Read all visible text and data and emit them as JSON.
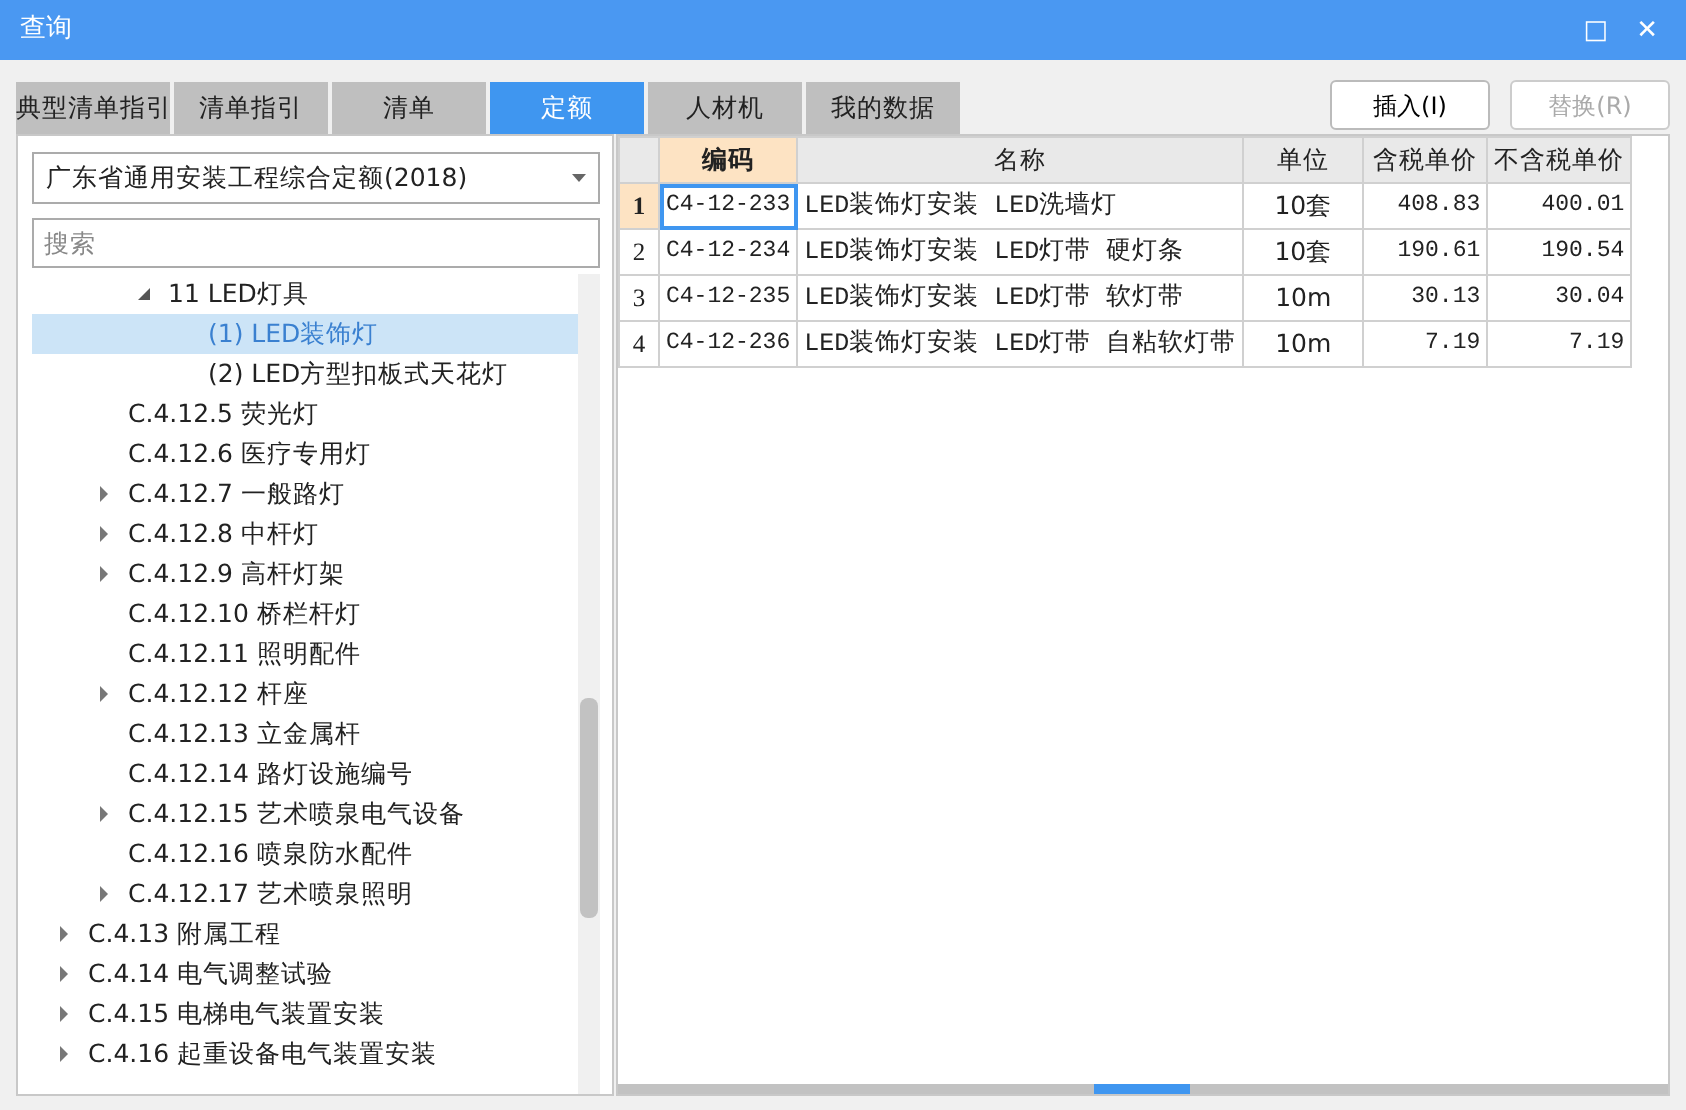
{
  "window": {
    "title": "查询",
    "buttons": [
      "□",
      "✕"
    ]
  },
  "tabs": [
    {
      "label": "典型清单指引",
      "selected": false
    },
    {
      "label": "清单指引",
      "selected": false
    },
    {
      "label": "清单",
      "selected": false
    },
    {
      "label": "定额",
      "selected": true
    },
    {
      "label": "人材机",
      "selected": false
    },
    {
      "label": "我的数据",
      "selected": false
    }
  ],
  "actions": [
    {
      "label": "插入(I)",
      "disabled": false
    },
    {
      "label": "替换(R)",
      "disabled": true
    }
  ],
  "library": {
    "value": "广东省通用安装工程综合定额(2018)"
  },
  "search": {
    "placeholder": "搜索"
  },
  "tree": [
    {
      "children": [
        {
          "children": [
            {
              "label": "11 LED灯具",
              "expanded": true,
              "selected": false,
              "children": [
                {
                  "label": "(1) LED装饰灯",
                  "selected": true
                },
                {
                  "label": "(2) LED方型扣板式天花灯",
                  "selected": false
                }
              ]
            }
          ]
        },
        {
          "label": "C.4.12.5 荧光灯",
          "selected": false
        },
        {
          "label": "C.4.12.6 医疗专用灯",
          "selected": false
        },
        {
          "label": "C.4.12.7 一般路灯",
          "expanded": false,
          "selected": false
        },
        {
          "label": "C.4.12.8 中杆灯",
          "expanded": false,
          "selected": false
        },
        {
          "label": "C.4.12.9 高杆灯架",
          "expanded": false,
          "selected": false
        },
        {
          "label": "C.4.12.10 桥栏杆灯",
          "selected": false
        },
        {
          "label": "C.4.12.11 照明配件",
          "selected": false
        },
        {
          "label": "C.4.12.12 杆座",
          "expanded": false,
          "selected": false
        },
        {
          "label": "C.4.12.13 立金属杆",
          "selected": false
        },
        {
          "label": "C.4.12.14 路灯设施编号",
          "selected": false
        },
        {
          "label": "C.4.12.15 艺术喷泉电气设备",
          "expanded": false,
          "selected": false
        },
        {
          "label": "C.4.12.16 喷泉防水配件",
          "selected": false
        },
        {
          "label": "C.4.12.17 艺术喷泉照明",
          "expanded": false,
          "selected": false
        }
      ]
    },
    {
      "label": "C.4.13 附属工程",
      "expanded": false,
      "selected": false
    },
    {
      "label": "C.4.14 电气调整试验",
      "expanded": false,
      "selected": false
    },
    {
      "label": "C.4.15 电梯电气装置安装",
      "expanded": false,
      "selected": false
    },
    {
      "label": "C.4.16 起重设备电气装置安装",
      "expanded": false,
      "selected": false
    }
  ],
  "table": {
    "columns": [
      {
        "label": "编码",
        "selected": true
      },
      {
        "label": "名称",
        "selected": false
      },
      {
        "label": "单位",
        "selected": false
      },
      {
        "label": "含税单价",
        "selected": false
      },
      {
        "label": "不含税单价",
        "selected": false
      }
    ],
    "rows": [
      {
        "number": "1",
        "selected": true,
        "cells": [
          "C4-12-233",
          "LED装饰灯安装 LED洗墙灯",
          "10套",
          "408.83",
          "400.01"
        ]
      },
      {
        "number": "2",
        "selected": false,
        "cells": [
          "C4-12-234",
          "LED装饰灯安装 LED灯带 硬灯条",
          "10套",
          "190.61",
          "190.54"
        ]
      },
      {
        "number": "3",
        "selected": false,
        "cells": [
          "C4-12-235",
          "LED装饰灯安装 LED灯带 软灯带",
          "10m",
          "30.13",
          "30.04"
        ]
      },
      {
        "number": "4",
        "selected": false,
        "cells": [
          "C4-12-236",
          "LED装饰灯安装 LED灯带 自粘软灯带",
          "10m",
          "7.19",
          "7.19"
        ]
      }
    ]
  }
}
